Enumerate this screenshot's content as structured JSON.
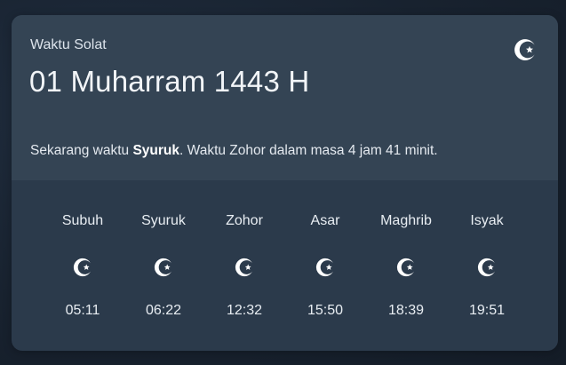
{
  "widget": {
    "label": "Waktu Solat",
    "date": "01 Muharram 1443 H",
    "header_icon": "moon-star-icon",
    "status": {
      "prefix": "Sekarang waktu ",
      "current": "Syuruk",
      "suffix": ". Waktu Zohor dalam masa 4 jam 41 minit."
    },
    "prayers": [
      {
        "name": "Subuh",
        "time": "05:11",
        "icon": "moon-star-icon"
      },
      {
        "name": "Syuruk",
        "time": "06:22",
        "icon": "moon-star-icon"
      },
      {
        "name": "Zohor",
        "time": "12:32",
        "icon": "moon-star-icon"
      },
      {
        "name": "Asar",
        "time": "15:50",
        "icon": "moon-star-icon"
      },
      {
        "name": "Maghrib",
        "time": "18:39",
        "icon": "moon-star-icon"
      },
      {
        "name": "Isyak",
        "time": "19:51",
        "icon": "moon-star-icon"
      }
    ]
  },
  "colors": {
    "background": "#18222f",
    "card": "#2b3a4b",
    "card_header": "#344454",
    "text": "#e8edf2"
  }
}
